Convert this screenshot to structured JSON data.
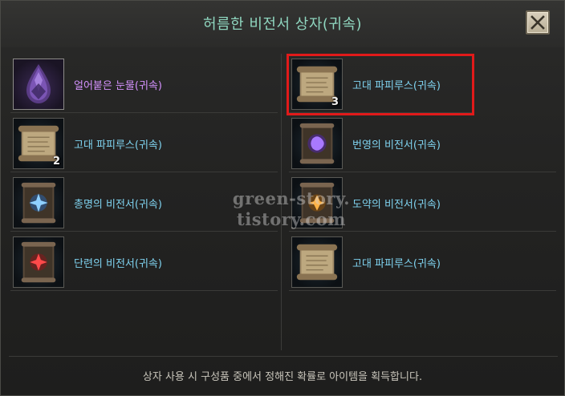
{
  "window": {
    "title": "허름한 비전서 상자(귀속)"
  },
  "items_left": [
    {
      "name": "얼어붙은 눈물(귀속)",
      "count": "",
      "icon": "frozen-tear-icon",
      "color": "purple"
    },
    {
      "name": "고대 파피루스(귀속)",
      "count": "2",
      "icon": "papyrus-scroll-icon",
      "color": "blue"
    },
    {
      "name": "총명의 비전서(귀속)",
      "count": "",
      "icon": "blue-rune-tome-icon",
      "color": "blue"
    },
    {
      "name": "단련의 비전서(귀속)",
      "count": "",
      "icon": "red-rune-tome-icon",
      "color": "blue"
    }
  ],
  "items_right": [
    {
      "name": "고대 파피루스(귀속)",
      "count": "3",
      "icon": "papyrus-scroll-icon",
      "color": "blue",
      "highlighted": true
    },
    {
      "name": "번영의 비전서(귀속)",
      "count": "",
      "icon": "purple-rune-tome-icon",
      "color": "blue"
    },
    {
      "name": "도약의 비전서(귀속)",
      "count": "",
      "icon": "orange-rune-tome-icon",
      "color": "blue"
    },
    {
      "name": "고대 파피루스(귀속)",
      "count": "",
      "icon": "papyrus-scroll-icon",
      "color": "blue"
    }
  ],
  "footer": {
    "text": "상자 사용 시 구성품 중에서 정해진 확률로 아이템을 획득합니다."
  },
  "watermark": {
    "line1": "green-story.",
    "line2": "tistory.com"
  },
  "colors": {
    "title": "#8fd6bf",
    "item_name": "#7fd3f0",
    "rare_name": "#d592ff",
    "highlight": "#e11a1a"
  }
}
